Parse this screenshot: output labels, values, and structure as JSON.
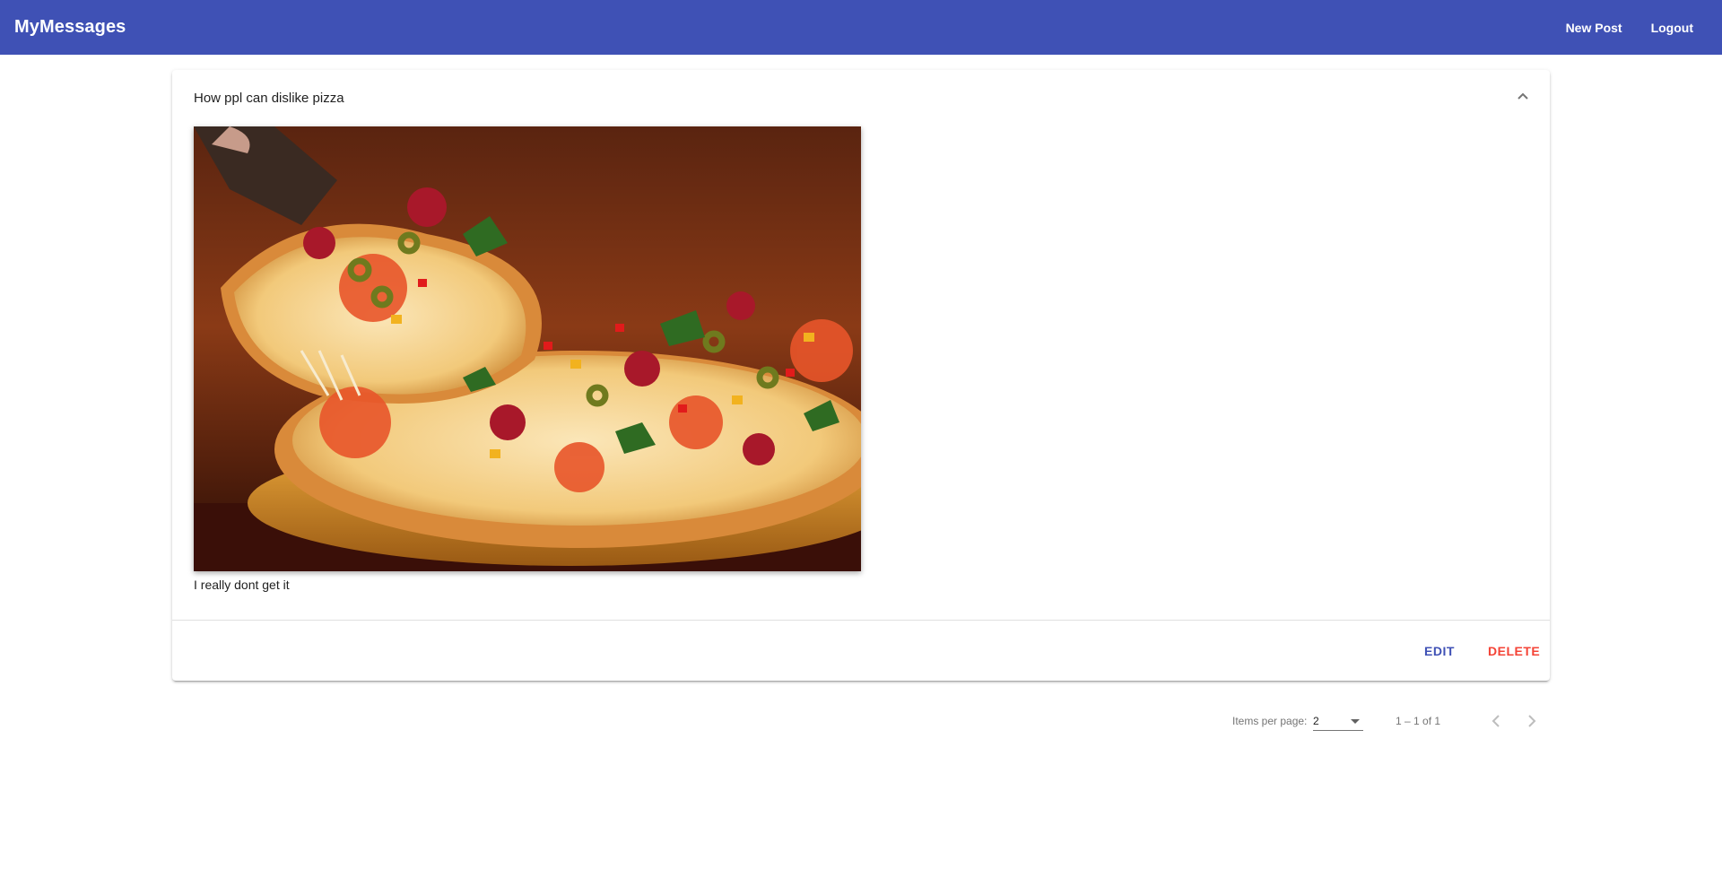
{
  "toolbar": {
    "title": "MyMessages",
    "new_post": "New Post",
    "logout": "Logout"
  },
  "post": {
    "title": "How ppl can dislike pizza",
    "content": "I really dont get it",
    "image_icon": "pizza-photo",
    "edit": "EDIT",
    "delete": "DELETE",
    "expanded": true
  },
  "paginator": {
    "items_per_page_label": "Items per page:",
    "page_size": "2",
    "range": "1 – 1 of 1"
  },
  "colors": {
    "primary": "#3f51b5",
    "warn": "#f44336"
  }
}
